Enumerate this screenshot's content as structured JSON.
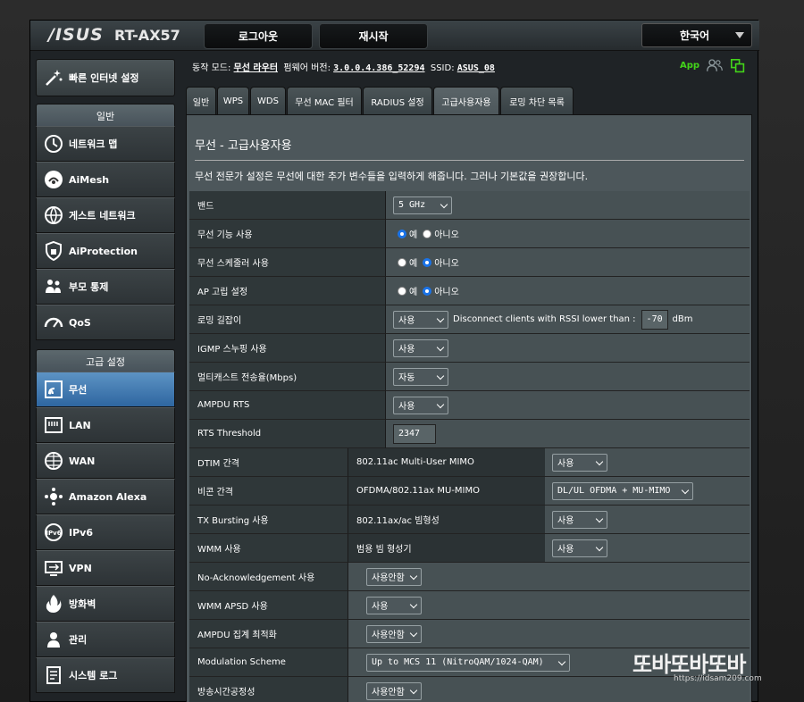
{
  "header": {
    "logo": "/ISUS",
    "model": "RT-AX57",
    "logout": "로그아웃",
    "restart": "재시작",
    "language": "한국어"
  },
  "status": {
    "mode_label": "동작 모드:",
    "mode_value": "무선 라우터",
    "fw_label": "펌웨어 버전:",
    "fw_value": "3.0.0.4.386_52294",
    "ssid_label": "SSID:",
    "ssid_value": "ASUS_08",
    "app_label": "App"
  },
  "sidebar": {
    "quick_setup": "빠른 인터넷 설정",
    "general_header": "일반",
    "general_items": [
      {
        "label": "네트워크 맵",
        "icon": "network-map-icon"
      },
      {
        "label": "AiMesh",
        "icon": "aimesh-icon"
      },
      {
        "label": "게스트 네트워크",
        "icon": "guest-network-icon"
      },
      {
        "label": "AiProtection",
        "icon": "shield-icon"
      },
      {
        "label": "부모 통제",
        "icon": "family-icon"
      },
      {
        "label": "QoS",
        "icon": "gauge-icon"
      }
    ],
    "advanced_header": "고급 설정",
    "advanced_items": [
      {
        "label": "무선",
        "icon": "wifi-icon"
      },
      {
        "label": "LAN",
        "icon": "lan-icon"
      },
      {
        "label": "WAN",
        "icon": "globe-icon"
      },
      {
        "label": "Amazon Alexa",
        "icon": "alexa-icon"
      },
      {
        "label": "IPv6",
        "icon": "ipv6-icon"
      },
      {
        "label": "VPN",
        "icon": "vpn-icon"
      },
      {
        "label": "방화벽",
        "icon": "firewall-icon"
      },
      {
        "label": "관리",
        "icon": "admin-icon"
      },
      {
        "label": "시스템 로그",
        "icon": "log-icon"
      }
    ]
  },
  "tabs": [
    "일반",
    "WPS",
    "WDS",
    "무선 MAC 필터",
    "RADIUS 설정",
    "고급사용자용",
    "로밍 차단 목록"
  ],
  "panel": {
    "title": "무선 - 고급사용자용",
    "description": "무선 전문가 설정은 무선에 대한 추가 변수들을 입력하게 해줍니다. 그러나 기본값을 권장합니다."
  },
  "settings": {
    "band": {
      "label": "밴드",
      "value": "5 GHz"
    },
    "radio_enable": {
      "label": "무선 기능 사용",
      "yes": "예",
      "no": "아니오"
    },
    "scheduler": {
      "label": "무선 스케줄러 사용",
      "yes": "예",
      "no": "아니오"
    },
    "ap_isolate": {
      "label": "AP 고립 설정",
      "yes": "예",
      "no": "아니오"
    },
    "roaming": {
      "label": "로밍 길잡이",
      "value": "사용",
      "rssi_text": "Disconnect clients with RSSI lower than :",
      "rssi_value": "-70",
      "unit": "dBm"
    },
    "igmp": {
      "label": "IGMP 스누핑 사용",
      "value": "사용"
    },
    "multicast": {
      "label": "멀티캐스트 전송율(Mbps)",
      "value": "자동"
    },
    "ampdu_rts": {
      "label": "AMPDU RTS",
      "value": "사용"
    },
    "rts_threshold": {
      "label": "RTS Threshold",
      "value": "2347"
    },
    "dtim": {
      "label": "DTIM 간격",
      "sub_label": "802.11ac Multi-User MIMO",
      "sub_value": "사용"
    },
    "beacon": {
      "label": "비콘 간격",
      "sub_label": "OFDMA/802.11ax MU-MIMO",
      "sub_value": "DL/UL OFDMA + MU-MIMO"
    },
    "tx_bursting": {
      "label": "TX Bursting 사용",
      "sub_label": "802.11ax/ac 빔형성",
      "sub_value": "사용"
    },
    "wmm": {
      "label": "WMM 사용",
      "sub_label": "범용 빔 형성기",
      "sub_value": "사용"
    },
    "no_ack": {
      "label": "No-Acknowledgement 사용",
      "value": "사용안함"
    },
    "wmm_apsd": {
      "label": "WMM APSD 사용",
      "value": "사용"
    },
    "ampdu_opt": {
      "label": "AMPDU 집계 최적화",
      "value": "사용안함"
    },
    "modulation": {
      "label": "Modulation Scheme",
      "value": "Up to MCS 11 (NitroQAM/1024-QAM)"
    },
    "airtime": {
      "label": "방송시간공정성",
      "value": "사용안함"
    }
  },
  "watermark": {
    "title": "또바또바또바",
    "url": "https://idsam209.com"
  }
}
